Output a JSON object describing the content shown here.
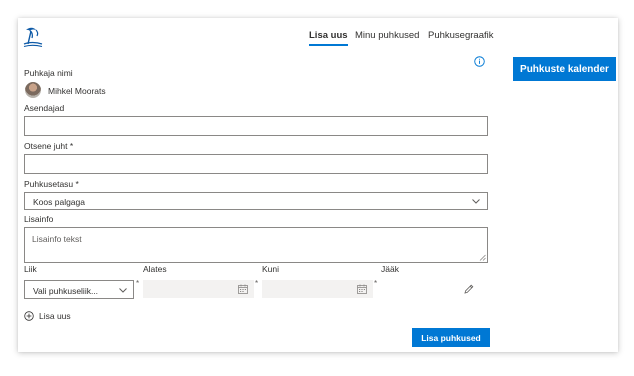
{
  "header": {
    "logo_icon": "palm-tree-beach-icon",
    "tabs": [
      {
        "label": "Lisa uus",
        "active": true
      },
      {
        "label": "Minu puhkused",
        "active": false
      },
      {
        "label": "Puhkusegraafik",
        "active": false
      }
    ],
    "calendar_button": "Puhkuste kalender"
  },
  "form": {
    "requester_label": "Puhkaja nimi",
    "requester_name": "Mihkel Moorats",
    "substitutes_label": "Asendajad",
    "substitutes_value": "",
    "manager_label": "Otsene juht *",
    "manager_value": "",
    "pay_label": "Puhkusetasu *",
    "pay_value": "Koos palgaga",
    "extra_label": "Lisainfo",
    "extra_placeholder": "Lisainfo tekst",
    "columns": {
      "type": "Liik",
      "from": "Alates",
      "to": "Kuni",
      "remaining": "Jääk"
    },
    "required_mark": "*",
    "type_placeholder": "Vali puhkuseliik...",
    "add_new": "Lisa uus",
    "submit": "Lisa puhkused"
  },
  "colors": {
    "accent": "#0078d4",
    "border": "#8a8886",
    "disabled_bg": "#f3f2f1"
  }
}
